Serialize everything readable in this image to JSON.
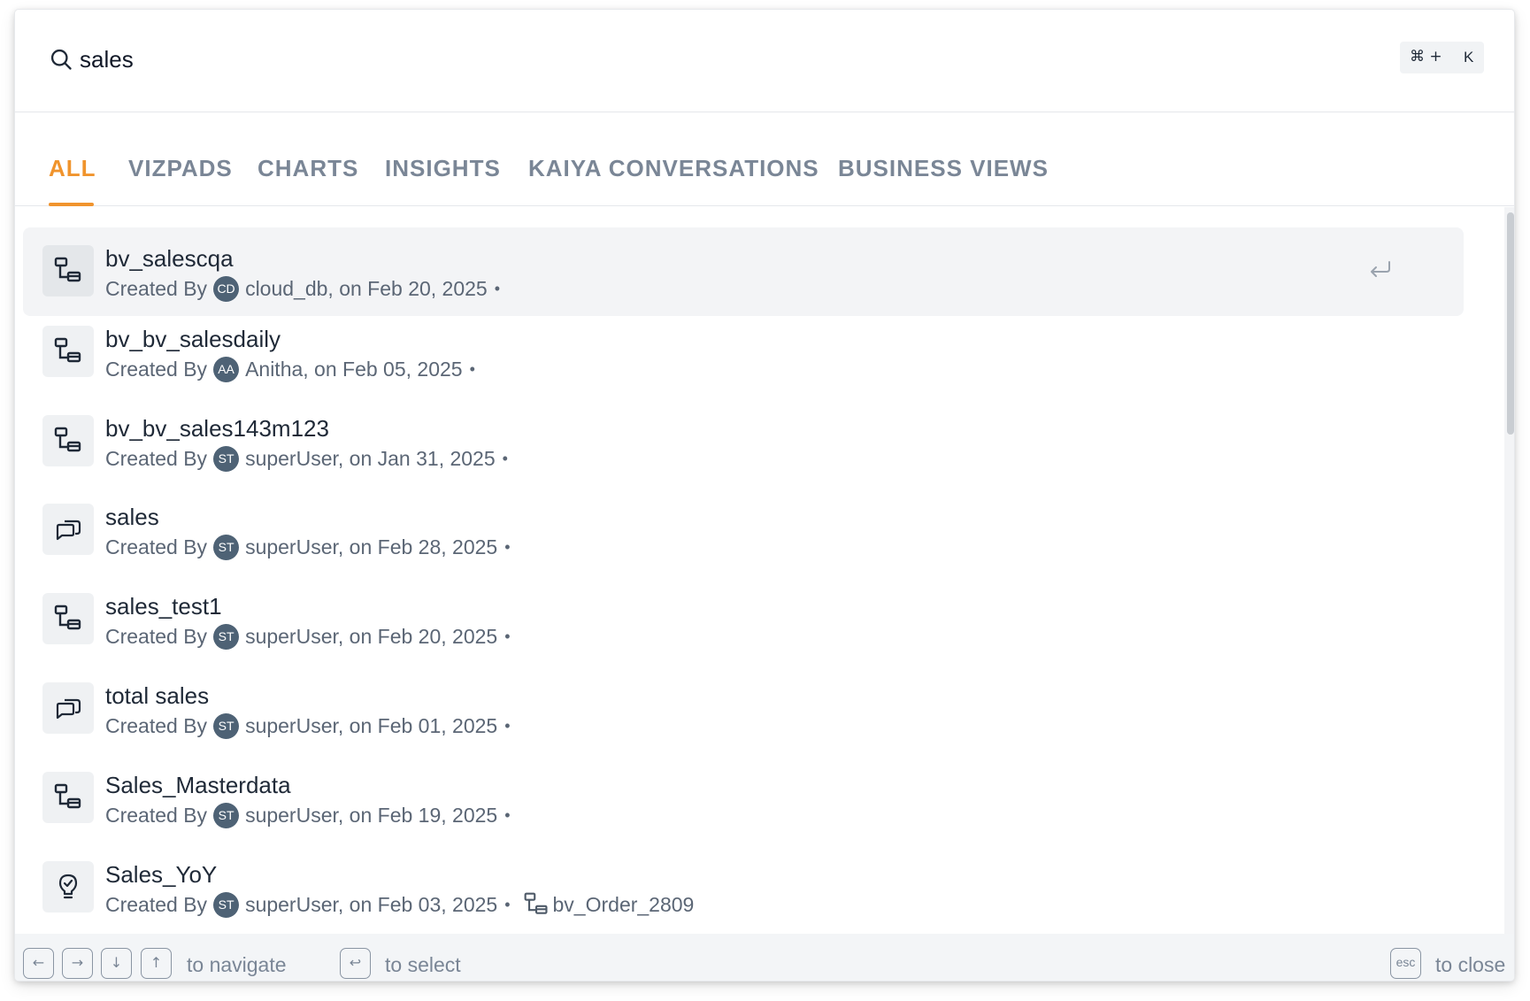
{
  "search": {
    "query": "sales",
    "shortcut_modifier": "⌘ +",
    "shortcut_key": "K"
  },
  "tabs": [
    {
      "label": "ALL",
      "active": true
    },
    {
      "label": "VIZPADS",
      "active": false
    },
    {
      "label": "CHARTS",
      "active": false
    },
    {
      "label": "INSIGHTS",
      "active": false
    },
    {
      "label": "KAIYA CONVERSATIONS",
      "active": false
    },
    {
      "label": "BUSINESS VIEWS",
      "active": false
    }
  ],
  "results": [
    {
      "title": "bv_salescqa",
      "created_label": "Created By",
      "avatar": "CD",
      "meta": "cloud_db, on Feb 20, 2025",
      "dot": "•",
      "icon": "business-view-icon",
      "selected": true
    },
    {
      "title": "bv_bv_salesdaily",
      "created_label": "Created By",
      "avatar": "AA",
      "meta": "Anitha, on Feb 05, 2025",
      "dot": "•",
      "icon": "business-view-icon"
    },
    {
      "title": "bv_bv_sales143m123",
      "created_label": "Created By",
      "avatar": "ST",
      "meta": "superUser, on Jan 31, 2025",
      "dot": "•",
      "icon": "business-view-icon"
    },
    {
      "title": "sales",
      "created_label": "Created By",
      "avatar": "ST",
      "meta": "superUser, on Feb 28, 2025",
      "dot": "•",
      "icon": "conversation-icon"
    },
    {
      "title": "sales_test1",
      "created_label": "Created By",
      "avatar": "ST",
      "meta": "superUser, on Feb 20, 2025",
      "dot": "•",
      "icon": "business-view-icon"
    },
    {
      "title": "total sales",
      "created_label": "Created By",
      "avatar": "ST",
      "meta": "superUser, on Feb 01, 2025",
      "dot": "•",
      "icon": "conversation-icon"
    },
    {
      "title": "Sales_Masterdata",
      "created_label": "Created By",
      "avatar": "ST",
      "meta": "superUser, on Feb 19, 2025",
      "dot": "•",
      "icon": "business-view-icon"
    },
    {
      "title": "Sales_YoY",
      "created_label": "Created By",
      "avatar": "ST",
      "meta": "superUser, on Feb 03, 2025",
      "dot": "•",
      "icon": "insight-icon",
      "linked": "bv_Order_2809"
    }
  ],
  "footer": {
    "navigate_keys": [
      "←",
      "→",
      "↓",
      "↑"
    ],
    "navigate_label": "to navigate",
    "select_key": "↩",
    "select_label": "to select",
    "close_key": "esc",
    "close_label": "to close"
  },
  "colors": {
    "accent": "#f0942d",
    "tab_inactive": "#7a8696",
    "avatar_bg": "#4e6275",
    "selected_row_bg": "#f3f4f6"
  }
}
